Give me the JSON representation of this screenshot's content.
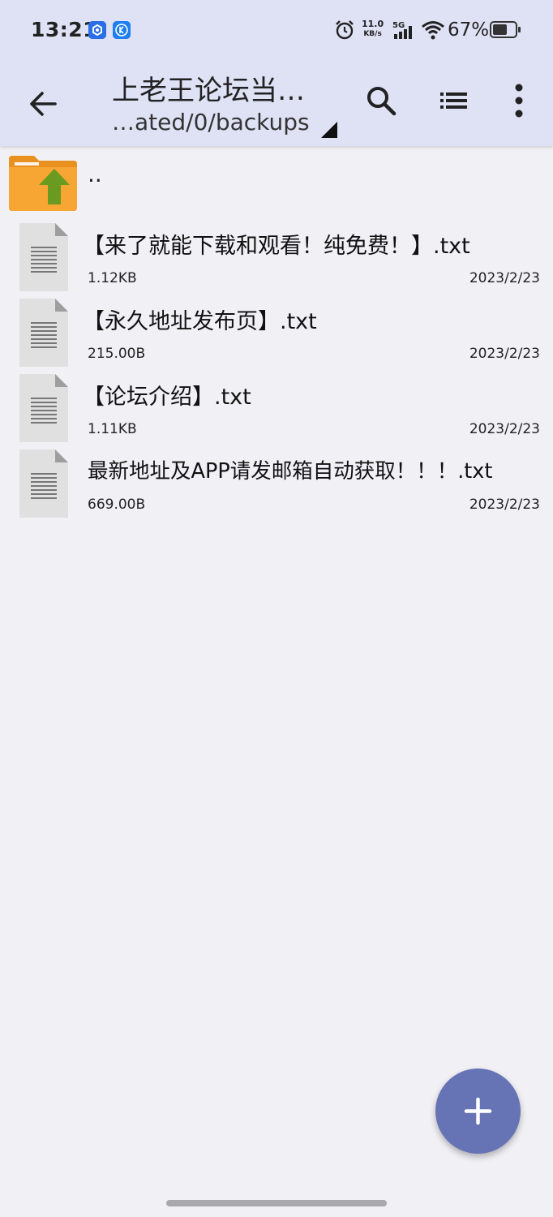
{
  "status": {
    "time": "13:21",
    "net_speed_value": "11.0",
    "net_speed_unit": "KB/s",
    "network": "5G",
    "battery": "67%",
    "battery_level": 0.67
  },
  "appbar": {
    "title": "上老王论坛当…",
    "subtitle": "…ated/0/backups"
  },
  "parent": {
    "label": ".."
  },
  "files": [
    {
      "name": "【来了就能下载和观看！纯免费！】.txt",
      "size": "1.12KB",
      "date": "2023/2/23"
    },
    {
      "name": "【永久地址发布页】.txt",
      "size": "215.00B",
      "date": "2023/2/23"
    },
    {
      "name": "【论坛介绍】.txt",
      "size": "1.11KB",
      "date": "2023/2/23"
    },
    {
      "name": "最新地址及APP请发邮箱自动获取！！！.txt",
      "size": "669.00B",
      "date": "2023/2/23"
    }
  ],
  "colors": {
    "appbar_bg": "#dfe1f5",
    "list_bg": "#f1f0f5",
    "fab": "#6673b5",
    "folder": "#f5a32a",
    "folder_arrow": "#6a9a1f"
  },
  "icons": [
    "back-arrow-icon",
    "search-icon",
    "list-view-icon",
    "more-vert-icon",
    "folder-up-icon",
    "text-file-icon",
    "plus-icon"
  ]
}
